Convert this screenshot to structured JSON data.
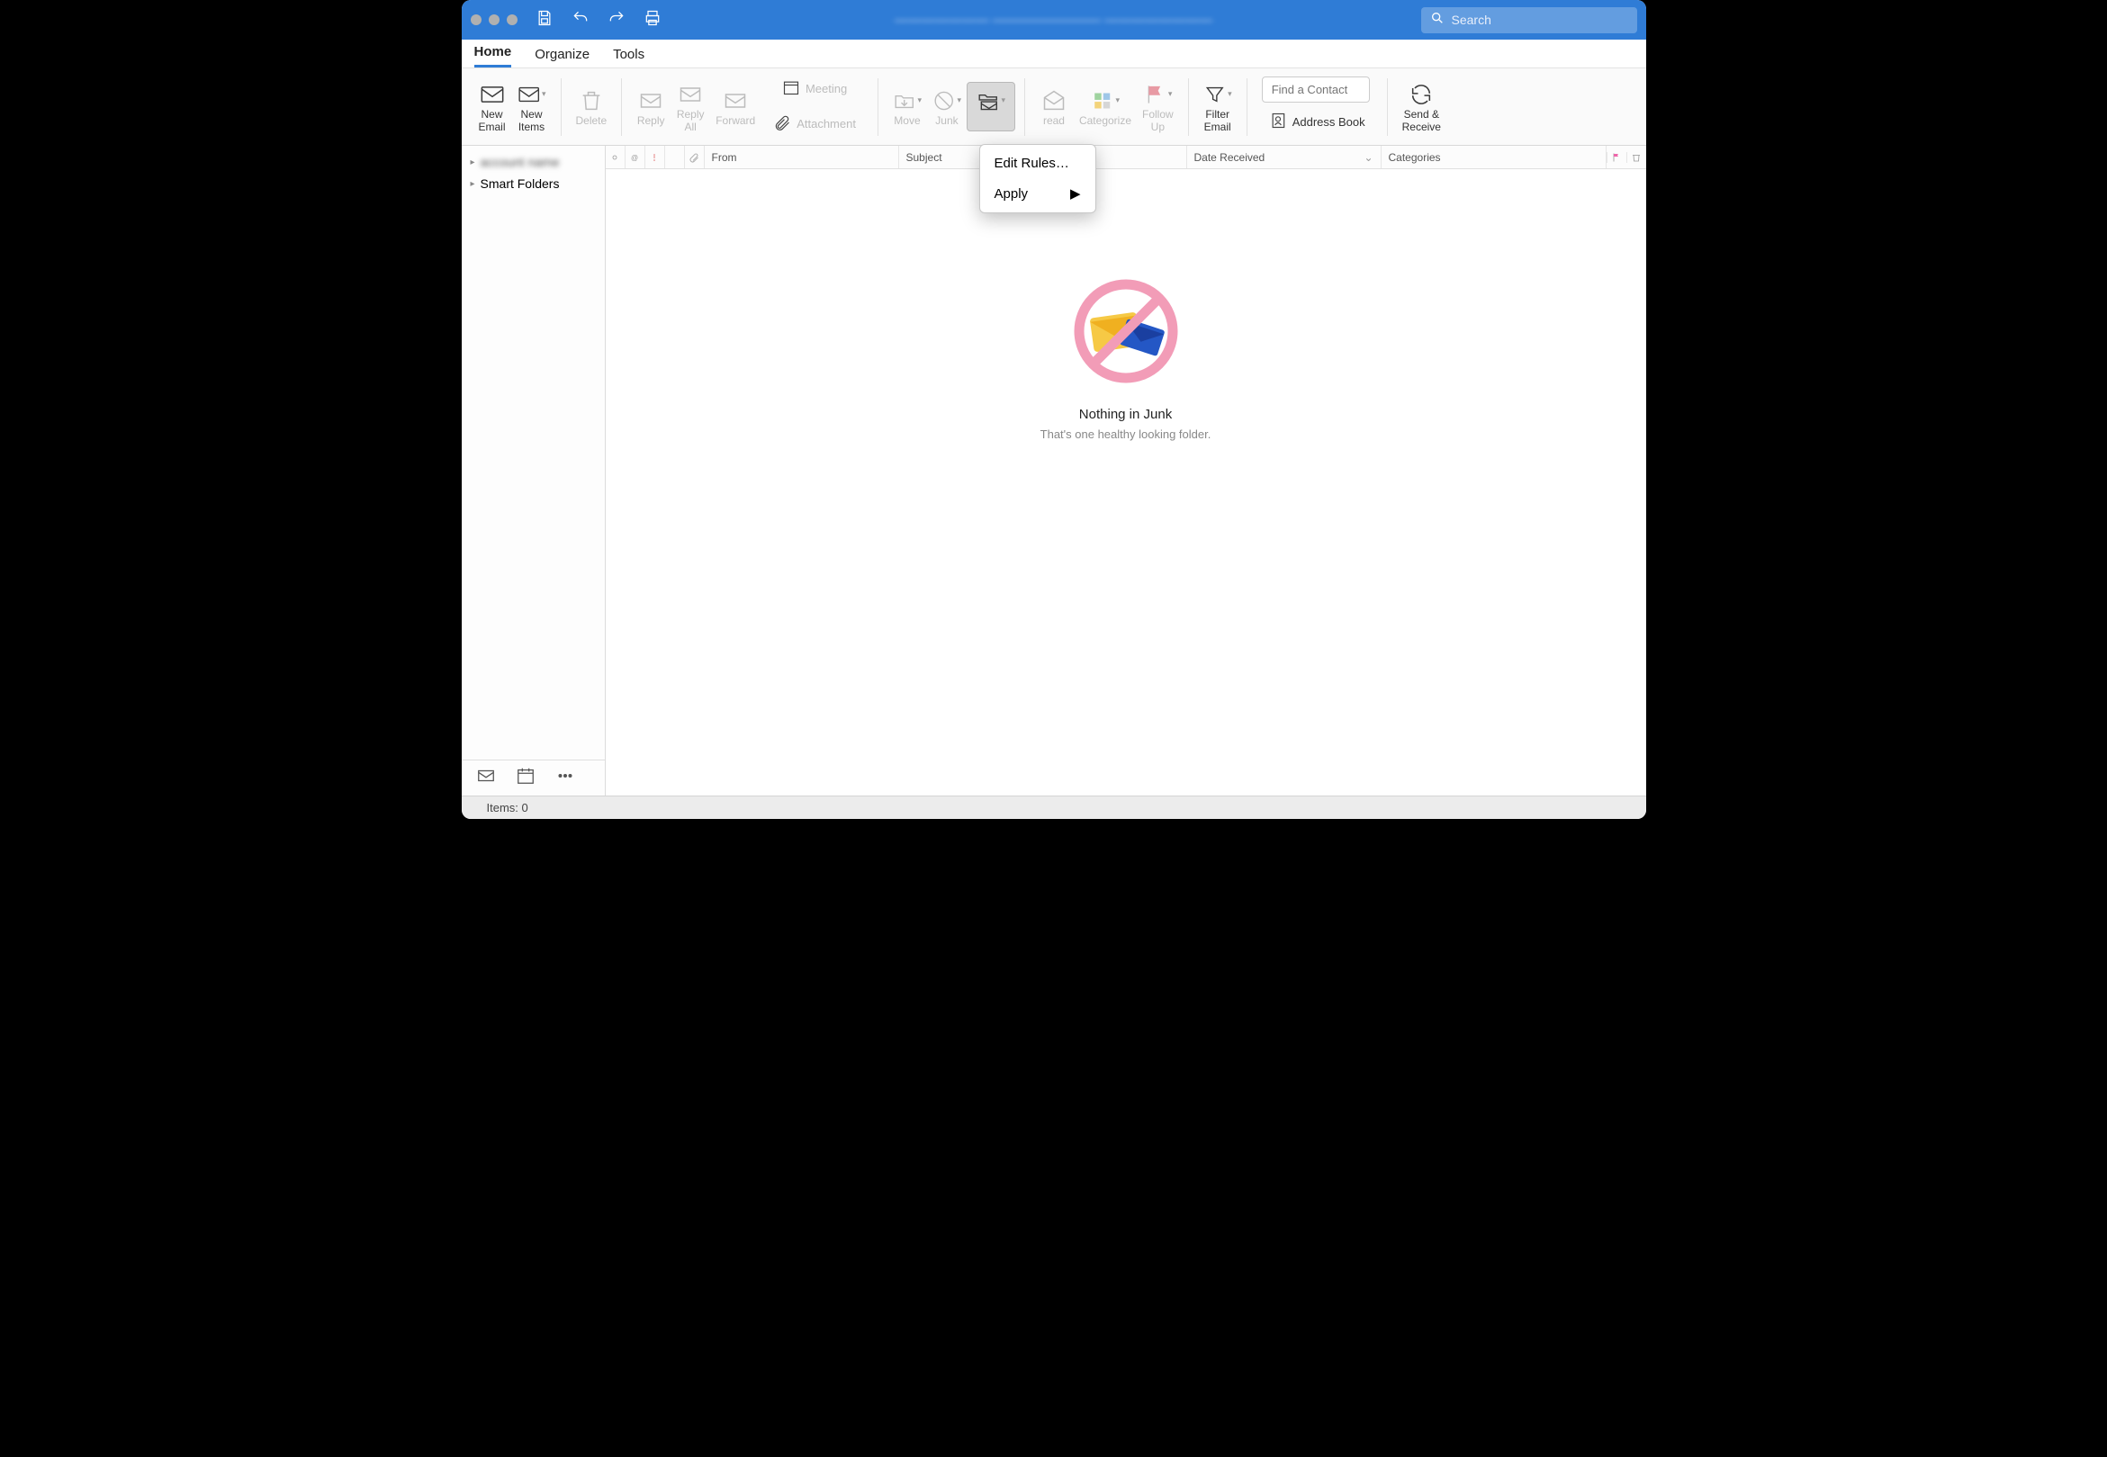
{
  "title_blurred_placeholder": "———————  ————————  ————————",
  "search_placeholder": "Search",
  "tabs": {
    "home": "Home",
    "organize": "Organize",
    "tools": "Tools"
  },
  "ribbon": {
    "new_email": "New\nEmail",
    "new_items": "New\nItems",
    "delete": "Delete",
    "reply": "Reply",
    "reply_all": "Reply\nAll",
    "forward": "Forward",
    "meeting": "Meeting",
    "attachment": "Attachment",
    "move": "Move",
    "junk": "Junk",
    "rules": "Rules",
    "read_unread": "Read /\nUnread",
    "read_tail": "read",
    "categorize": "Categorize",
    "follow_up": "Follow\nUp",
    "filter_email": "Filter\nEmail",
    "find_contact_placeholder": "Find a Contact",
    "address_book": "Address Book",
    "send_receive": "Send &\nReceive"
  },
  "rules_menu": {
    "edit": "Edit Rules…",
    "apply": "Apply"
  },
  "sidebar": {
    "account_blurred": "account name",
    "smart_folders": "Smart Folders"
  },
  "columns": {
    "from": "From",
    "subject": "Subject",
    "date_received": "Date Received",
    "categories": "Categories"
  },
  "empty": {
    "title": "Nothing in Junk",
    "subtitle": "That's one healthy looking folder."
  },
  "status": {
    "items_label": "Items:",
    "items_count": "0"
  }
}
